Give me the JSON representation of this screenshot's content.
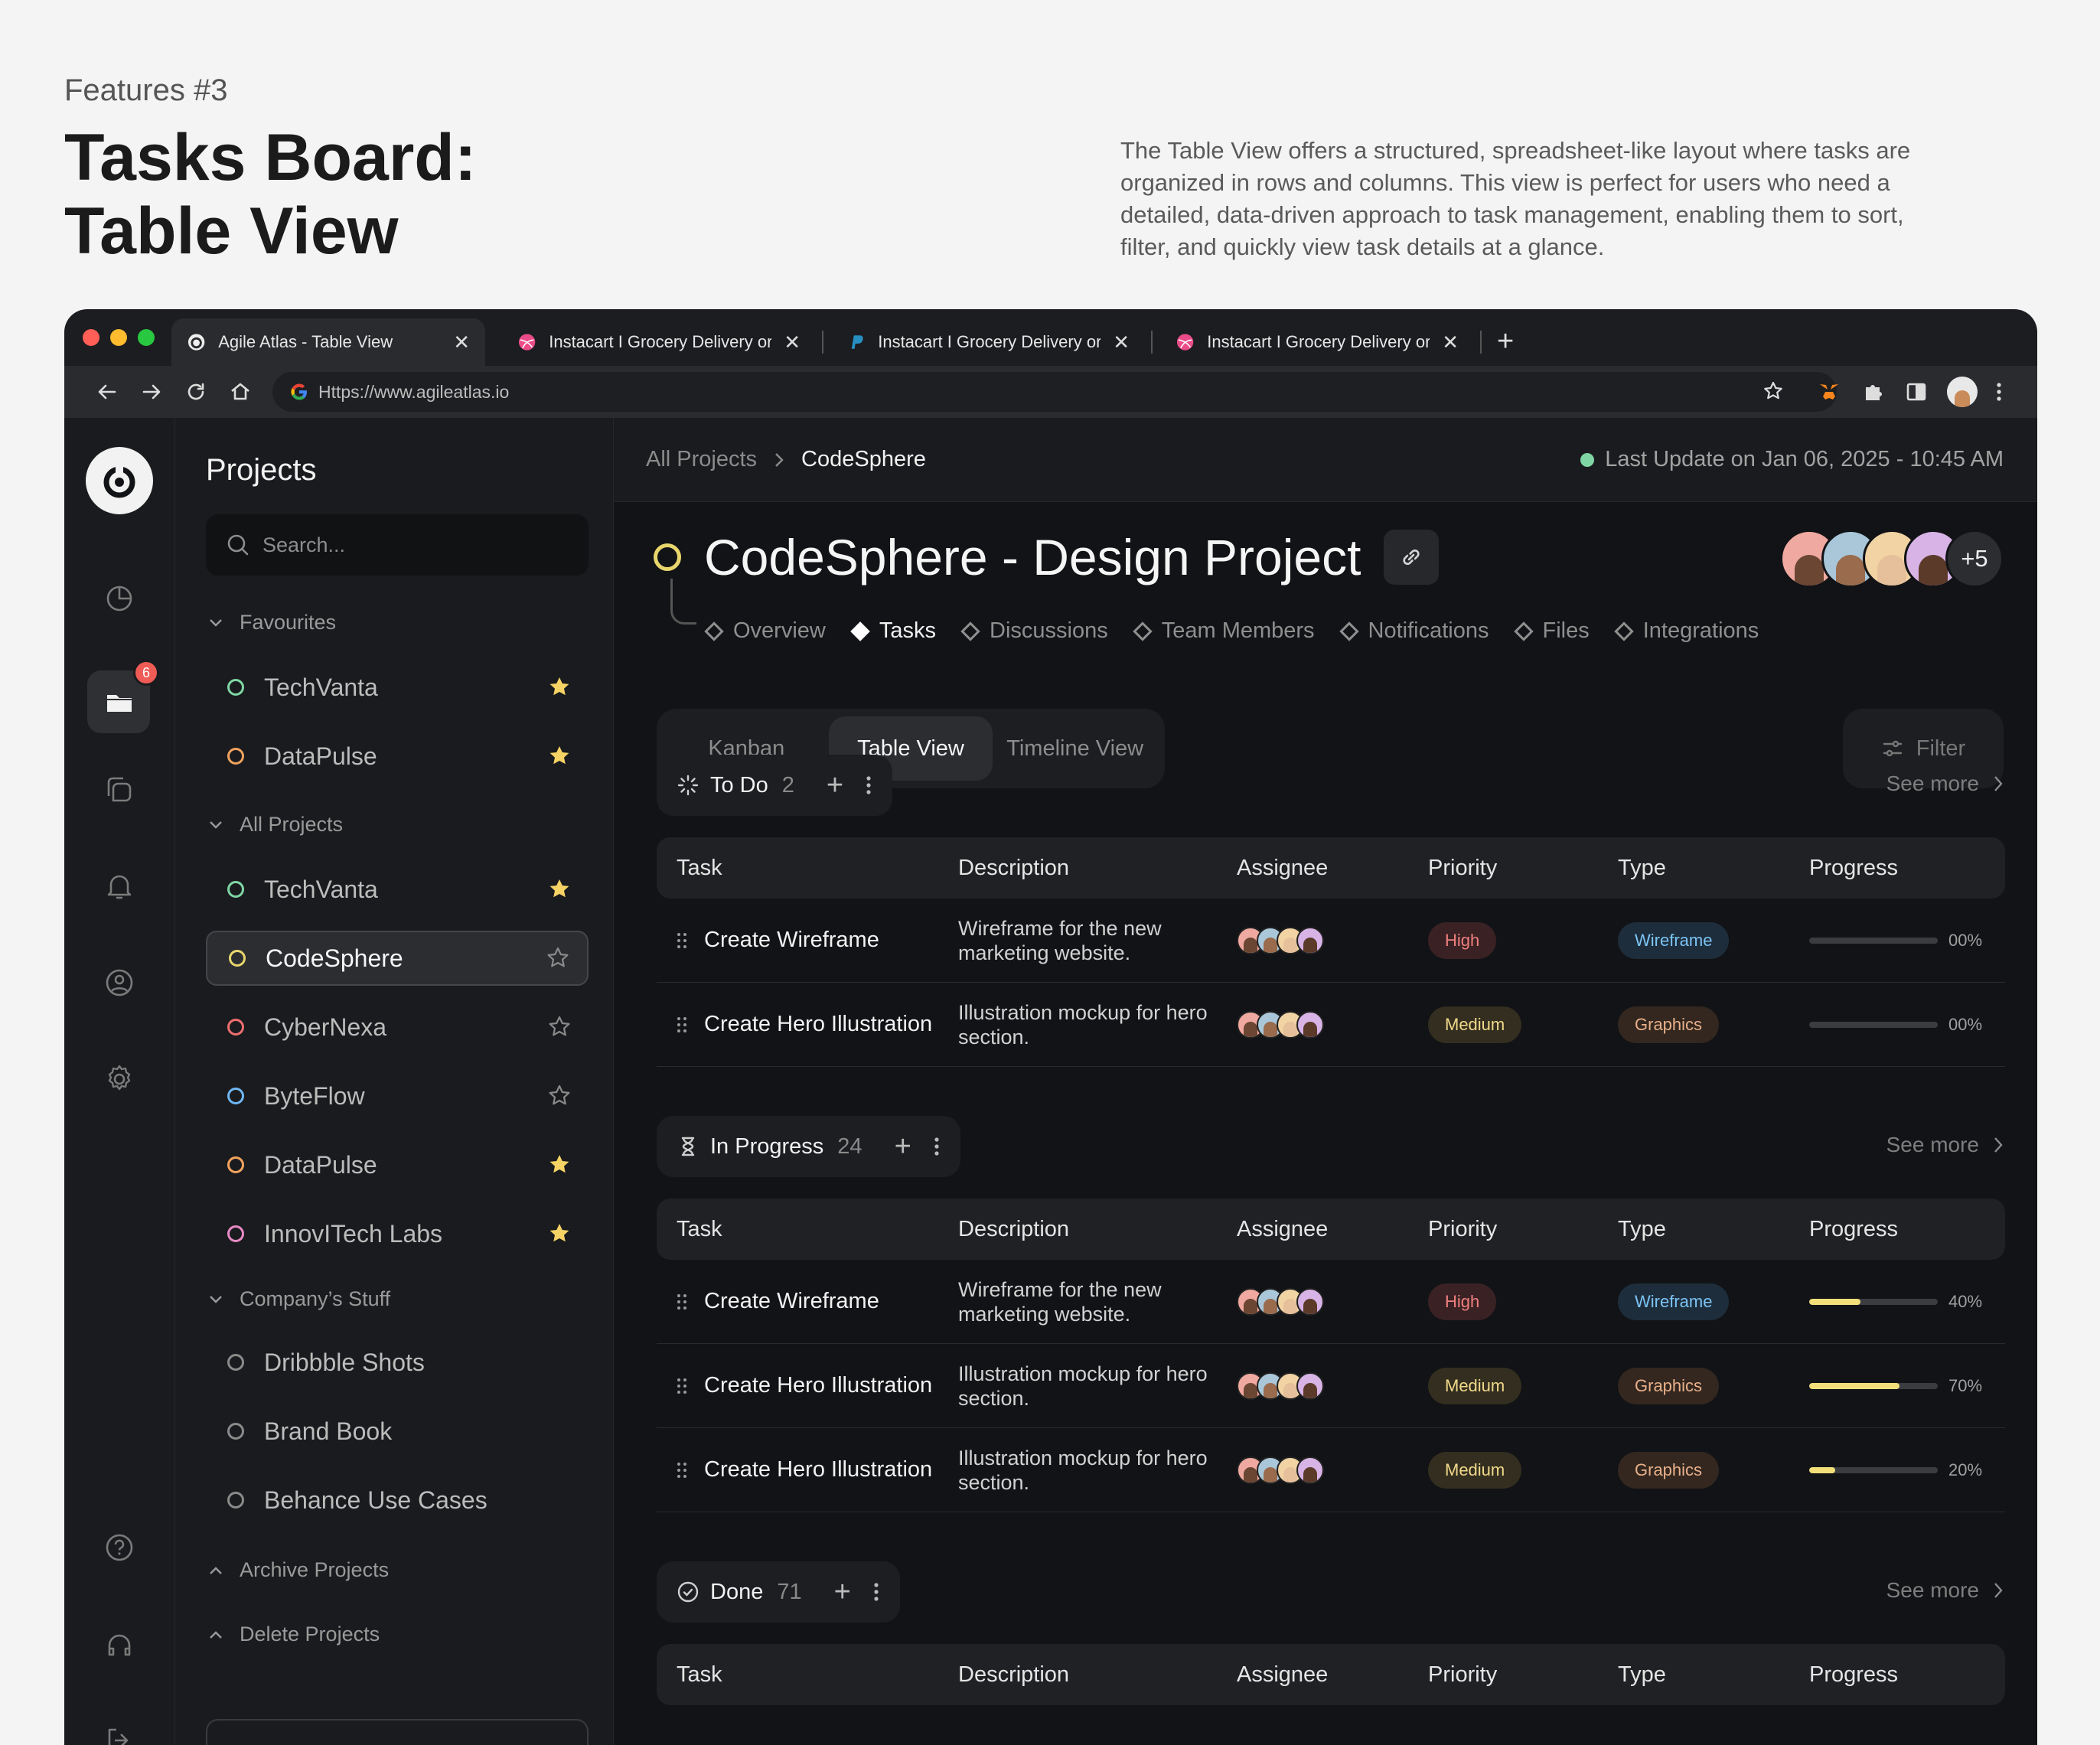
{
  "hero": {
    "kicker": "Features #3",
    "title_line1": "Tasks Board:",
    "title_line2": "Table View",
    "description": "The Table View offers a structured, spreadsheet-like layout where tasks are organized in rows and columns. This view is perfect for users who need a detailed, data-driven approach to task management, enabling them to sort, filter, and quickly view task details at a glance."
  },
  "browser": {
    "tabs": [
      {
        "title": "Agile Atlas - Table View",
        "icon": "agile-atlas-icon"
      },
      {
        "title": "Instacart I Grocery Delivery or",
        "icon": "dribbble-icon"
      },
      {
        "title": "Instacart I Grocery Delivery or",
        "icon": "paypal-icon"
      },
      {
        "title": "Instacart I Grocery Delivery or",
        "icon": "dribbble-icon"
      }
    ],
    "url": "Https://www.agileatlas.io"
  },
  "rail": {
    "notification_count": "6"
  },
  "sidebar": {
    "title": "Projects",
    "search_placeholder": "Search...",
    "groups": {
      "favourites": "Favourites",
      "all_projects": "All Projects",
      "company": "Company’s Stuff",
      "archive": "Archive Projects",
      "delete": "Delete Projects"
    },
    "favourites": [
      {
        "name": "TechVanta",
        "color": "#7fd6a4",
        "starred": true
      },
      {
        "name": "DataPulse",
        "color": "#f2a35e",
        "starred": true
      }
    ],
    "projects": [
      {
        "name": "TechVanta",
        "color": "#7fd6a4",
        "starred": true
      },
      {
        "name": "CodeSphere",
        "color": "#e8d66c",
        "starred": false,
        "selected": true
      },
      {
        "name": "CyberNexa",
        "color": "#ef6f6f",
        "starred": false
      },
      {
        "name": "ByteFlow",
        "color": "#6fb6f2",
        "starred": false
      },
      {
        "name": "DataPulse",
        "color": "#f2a35e",
        "starred": true
      },
      {
        "name": "InnovITech Labs",
        "color": "#e88ac5",
        "starred": true
      }
    ],
    "company": [
      {
        "name": "Dribbble Shots",
        "color": "#8a8a8a"
      },
      {
        "name": "Brand Book",
        "color": "#8a8a8a"
      },
      {
        "name": "Behance Use Cases",
        "color": "#8a8a8a"
      }
    ]
  },
  "main": {
    "breadcrumb": {
      "root": "All Projects",
      "current": "CodeSphere"
    },
    "last_update": "Last Update on Jan 06, 2025 - 10:45 AM",
    "project_title": "CodeSphere - Design Project",
    "avatar_more": "+5",
    "tabs": [
      "Overview",
      "Tasks",
      "Discussions",
      "Team Members",
      "Notifications",
      "Files",
      "Integrations"
    ],
    "active_tab": "Tasks",
    "views": [
      "Kanban",
      "Table View",
      "Timeline View"
    ],
    "active_view": "Table View",
    "filter_label": "Filter",
    "columns": [
      "Task",
      "Description",
      "Assignee",
      "Priority",
      "Type",
      "Progress"
    ],
    "see_more": "See more",
    "sections": [
      {
        "name": "To Do",
        "count": "2",
        "icon": "loader-icon",
        "rows": [
          {
            "task": "Create Wireframe",
            "description": "Wireframe for the new marketing website.",
            "priority": "High",
            "type": "Wireframe",
            "progress": 0,
            "progress_label": "00%"
          },
          {
            "task": "Create Hero Illustration",
            "description": "Illustration mockup for hero section.",
            "priority": "Medium",
            "type": "Graphics",
            "progress": 0,
            "progress_label": "00%"
          }
        ]
      },
      {
        "name": "In Progress",
        "count": "24",
        "icon": "hourglass-icon",
        "rows": [
          {
            "task": "Create Wireframe",
            "description": "Wireframe for the new marketing website.",
            "priority": "High",
            "type": "Wireframe",
            "progress": 40,
            "progress_label": "40%"
          },
          {
            "task": "Create Hero Illustration",
            "description": "Illustration mockup for hero section.",
            "priority": "Medium",
            "type": "Graphics",
            "progress": 70,
            "progress_label": "70%"
          },
          {
            "task": "Create Hero Illustration",
            "description": "Illustration mockup for hero section.",
            "priority": "Medium",
            "type": "Graphics",
            "progress": 20,
            "progress_label": "20%"
          }
        ]
      },
      {
        "name": "Done",
        "count": "71",
        "icon": "check-circle-icon",
        "rows": []
      }
    ]
  },
  "colors": {
    "accent_yellow": "#e8d66c",
    "priority_high_text": "#f07f7f",
    "priority_high_bg": "#3a2224",
    "priority_medium_text": "#f1d98a",
    "priority_medium_bg": "#332e1f",
    "type_wireframe_text": "#7cc4f5",
    "type_wireframe_bg": "#1d2d3b",
    "type_graphics_text": "#e9b08a",
    "type_graphics_bg": "#33271f",
    "online_dot": "#7fd6a4"
  }
}
